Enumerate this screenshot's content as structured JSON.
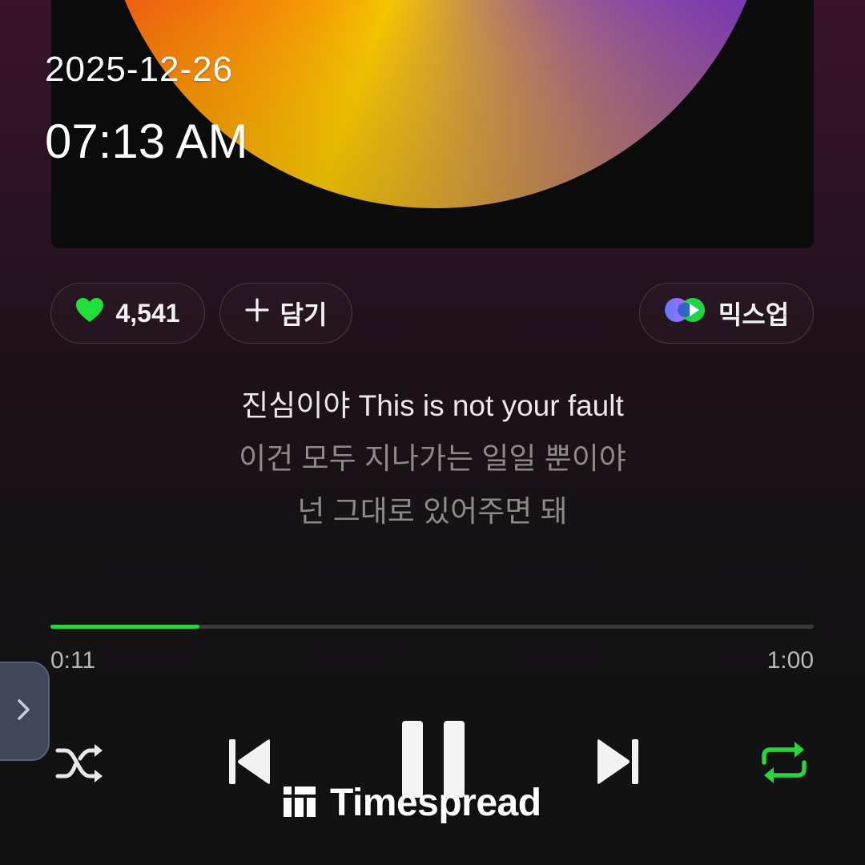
{
  "overlay": {
    "date": "2025-12-26",
    "time": "07:13 AM"
  },
  "actions": {
    "like_count": "4,541",
    "add_label": "담기",
    "mixup_label": "믹스업"
  },
  "lyrics": {
    "current": "진심이야 This is not your fault",
    "next1": "이건 모두 지나가는 일일 뿐이야",
    "next2": "넌 그대로 있어주면 돼"
  },
  "playback": {
    "elapsed": "0:11",
    "duration": "1:00",
    "progress": 0.195
  },
  "controls": {
    "shuffle": "shuffle-icon",
    "previous": "skip-previous-icon",
    "pause": "pause-icon",
    "next": "skip-next-icon",
    "repeat": "repeat-icon"
  },
  "watermark": {
    "text": "Timespread"
  },
  "colors": {
    "accent": "#26d63b",
    "heart": "#22e03a"
  }
}
